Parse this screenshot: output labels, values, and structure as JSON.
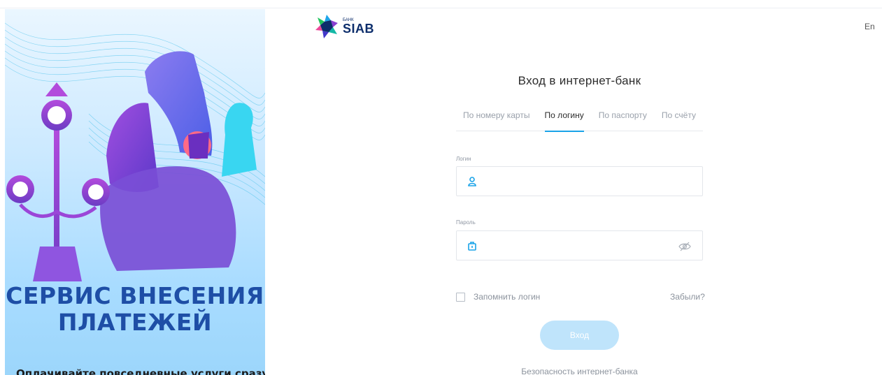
{
  "brand": {
    "small": "БАНК",
    "name": "SIAB"
  },
  "header": {
    "lang": "En"
  },
  "promo": {
    "title_line1": "СЕРВИС ВНЕСЕНИЯ",
    "title_line2": "ПЛАТЕЖЕЙ",
    "subtitle": "Оплачивайте повседневные услуги сразу и в"
  },
  "form": {
    "title": "Вход в интернет-банк",
    "tabs": [
      {
        "label": "По номеру карты",
        "active": false
      },
      {
        "label": "По логину",
        "active": true
      },
      {
        "label": "По паспорту",
        "active": false
      },
      {
        "label": "По счёту",
        "active": false
      }
    ],
    "login_label": "Логин",
    "login_value": "",
    "password_label": "Пароль",
    "password_value": "",
    "remember_label": "Запомнить логин",
    "remember_checked": false,
    "forgot_label": "Забыли?",
    "submit_label": "Вход",
    "security_link": "Безопасность интернет-банка"
  },
  "colors": {
    "accent": "#1aa3e8",
    "button_disabled": "#bfe4fb",
    "promo_title": "#1e4ea6"
  }
}
